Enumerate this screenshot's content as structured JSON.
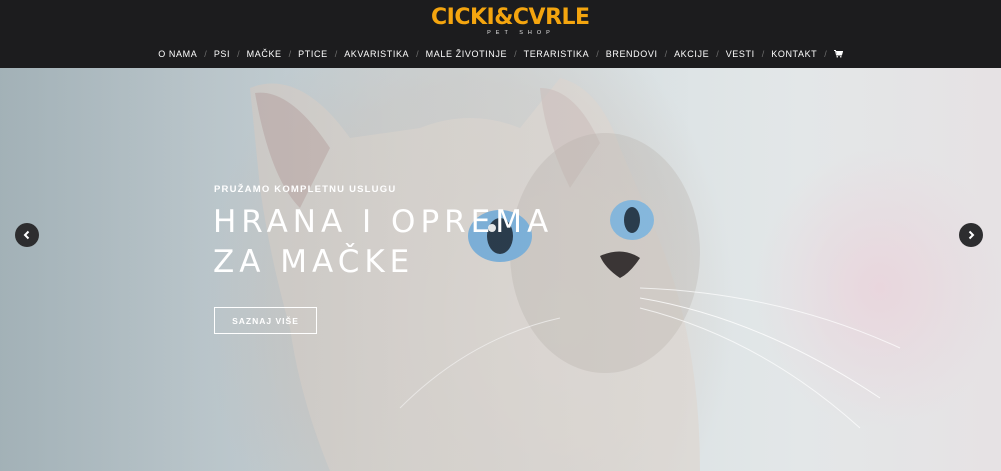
{
  "header": {
    "logo_main": "CICKI&CVRLE",
    "logo_sub": "PET SHOP",
    "brand_color": "#f4a50f",
    "background": "#1c1c1e"
  },
  "nav": {
    "items": [
      "O NAMA",
      "PSI",
      "MAČKE",
      "PTICE",
      "AKVARISTIKA",
      "MALE ŽIVOTINJE",
      "TERARISTIKA",
      "BRENDOVI",
      "AKCIJE",
      "VESTI",
      "KONTAKT"
    ],
    "separator": "/",
    "cart_icon": "cart-icon"
  },
  "hero": {
    "eyebrow": "PRUŽAMO KOMPLETNU USLUGU",
    "headline_line1": "HRANA I OPREMA",
    "headline_line2": "ZA MAČKE",
    "cta_label": "SAZNAJ VIŠE",
    "prev_icon": "chevron-left-icon",
    "next_icon": "chevron-right-icon"
  }
}
